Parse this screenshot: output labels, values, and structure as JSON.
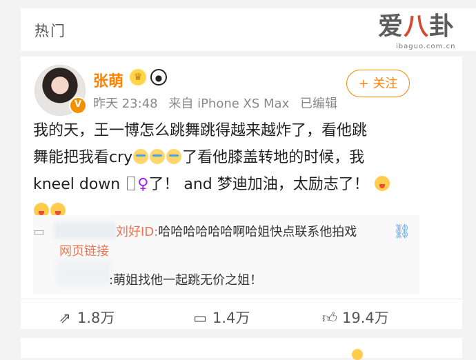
{
  "header": {
    "title": "热门"
  },
  "watermark": {
    "brand_part1": "爱",
    "brand_part2": "八",
    "brand_part3": "卦",
    "sub": "ibaguo.com.cn"
  },
  "post": {
    "author": "张萌",
    "time": "昨天 23:48",
    "source": "来自 iPhone XS Max",
    "edited": "已编辑",
    "follow_label": "+ 关注",
    "text_line1": "我的天，王一博怎么跳舞跳得越来越炸了，看他跳",
    "text_line2a": "舞能把我看cry",
    "text_line2b": "了看他膝盖转地的时候，我",
    "text_line3a": "kneel down",
    "text_line3b": "了！ and 梦迪加油，太励志了！",
    "venus": "♀"
  },
  "comments": {
    "c1_name": "刘好ID:",
    "c1_text": "哈哈哈哈哈哈啊哈姐快点联系他拍戏",
    "web_link": "网页链接",
    "c2_text": ":萌姐找他一起跳无价之姐！"
  },
  "actions": {
    "repost": "1.8万",
    "comment": "1.4万",
    "like": "19.4万"
  },
  "colors": {
    "accent": "#ff8200",
    "link": "#eb7350",
    "text": "#222222",
    "meta": "#888888"
  }
}
